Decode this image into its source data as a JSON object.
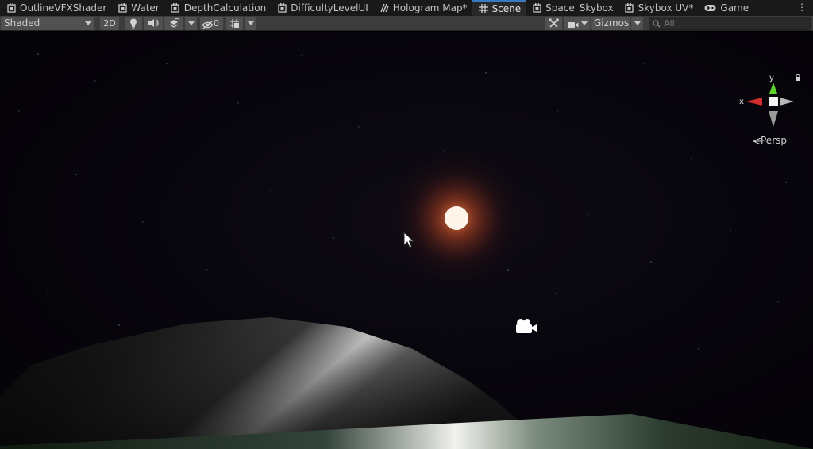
{
  "tabs": [
    {
      "label": "OutlineVFXShader",
      "icon": "shader-graph-icon",
      "active": false
    },
    {
      "label": "Water",
      "icon": "shader-graph-icon",
      "active": false
    },
    {
      "label": "DepthCalculation",
      "icon": "shader-graph-icon",
      "active": false
    },
    {
      "label": "DifficultyLevelUI",
      "icon": "shader-graph-icon",
      "active": false
    },
    {
      "label": "Hologram Map*",
      "icon": "vfx-graph-icon",
      "active": false
    },
    {
      "label": "Scene",
      "icon": "grid-icon",
      "active": true
    },
    {
      "label": "Space_Skybox",
      "icon": "shader-graph-icon",
      "active": false
    },
    {
      "label": "Skybox UV*",
      "icon": "shader-graph-icon",
      "active": false
    },
    {
      "label": "Game",
      "icon": "gamepad-icon",
      "active": false
    }
  ],
  "tab_more_label": "⋮",
  "toolbar": {
    "draw_mode": "Shaded",
    "mode_2d": "2D",
    "hidden_count": "0",
    "gizmos_label": "Gizmos",
    "search_placeholder": "All"
  },
  "scene_gizmo": {
    "x_label": "x",
    "y_label": "y",
    "projection": "Persp",
    "colors": {
      "x": "#d22c2c",
      "y": "#5fd32c",
      "z": "#b0b0b0"
    }
  },
  "colors": {
    "tabbar_bg": "#191919",
    "toolbar_bg": "#3c3c3c",
    "active_tab_accent": "#3a79bb",
    "sun": "#fff4ea",
    "sun_glow": "#ff7a3c",
    "ground": "#203020"
  }
}
